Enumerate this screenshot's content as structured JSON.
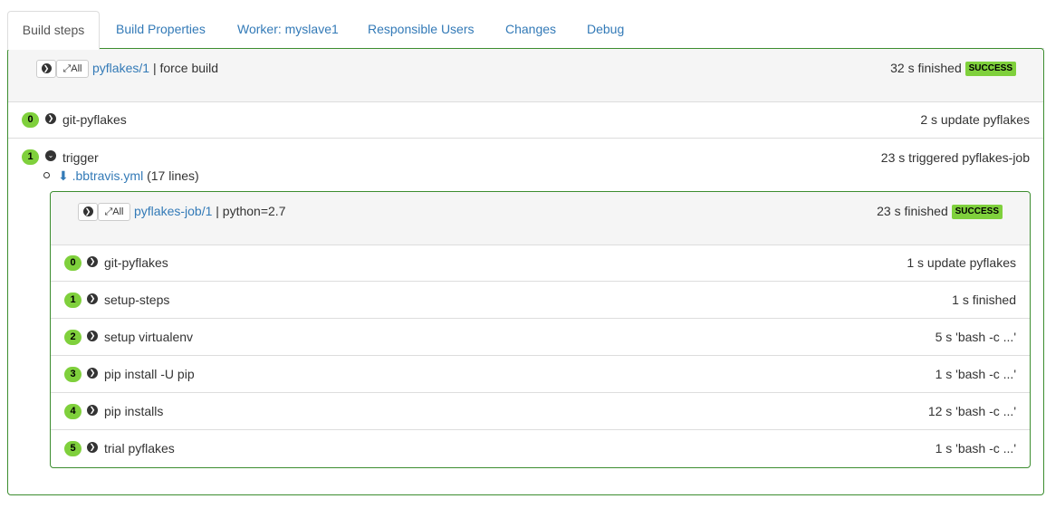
{
  "tabs": [
    "Build steps",
    "Build Properties",
    "Worker: myslave1",
    "Responsible Users",
    "Changes",
    "Debug"
  ],
  "build": {
    "expand_all_label": "All",
    "link": "pyflakes/1",
    "reason": "| force build",
    "summary": "32 s finished",
    "status": "SUCCESS",
    "steps": [
      {
        "num": "0",
        "name": "git-pyflakes",
        "summary": "2 s update pyflakes"
      },
      {
        "num": "1",
        "name": "trigger",
        "summary": "23 s triggered pyflakes-job"
      }
    ],
    "trigger_file": {
      "link": ".bbtravis.yml",
      "lines": "(17 lines)"
    }
  },
  "subbuild": {
    "expand_all_label": "All",
    "link": "pyflakes-job/1",
    "reason": "| python=2.7",
    "summary": "23 s finished",
    "status": "SUCCESS",
    "steps": [
      {
        "num": "0",
        "name": "git-pyflakes",
        "summary": "1 s update pyflakes"
      },
      {
        "num": "1",
        "name": "setup-steps",
        "summary": "1 s finished"
      },
      {
        "num": "2",
        "name": "setup virtualenv",
        "summary": "5 s 'bash -c ...'"
      },
      {
        "num": "3",
        "name": "pip install -U pip",
        "summary": "1 s 'bash -c ...'"
      },
      {
        "num": "4",
        "name": "pip installs",
        "summary": "12 s 'bash -c ...'"
      },
      {
        "num": "5",
        "name": "trial pyflakes",
        "summary": "1 s 'bash -c ...'"
      }
    ]
  },
  "colors": {
    "success_badge": "#7fd03c",
    "panel_border": "#3c8d2f",
    "link": "#337ab7"
  },
  "icons": {
    "expand": "chevron-circle-right-icon",
    "collapse": "chevron-circle-down-icon",
    "expand_all": "arrows-diagonal-icon",
    "download": "download-icon"
  }
}
